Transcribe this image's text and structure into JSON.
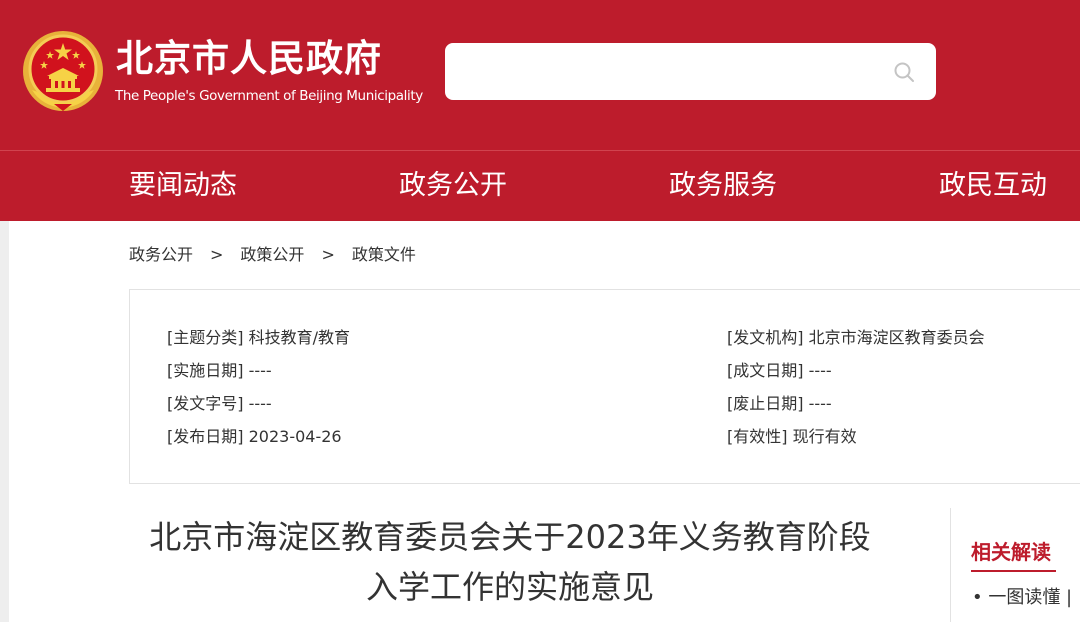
{
  "header": {
    "title": "北京市人民政府",
    "subtitle": "The People's Government of Beijing Municipality",
    "emblem_icon": "national-emblem-icon",
    "background_color": "#bd1c2c"
  },
  "search": {
    "value": "",
    "placeholder": "",
    "icon": "search-icon"
  },
  "nav": {
    "items": [
      {
        "label": "要闻动态"
      },
      {
        "label": "政务公开"
      },
      {
        "label": "政务服务"
      },
      {
        "label": "政民互动"
      }
    ]
  },
  "breadcrumb": {
    "items": [
      "政务公开",
      "政策公开",
      "政策文件"
    ],
    "separator": ">"
  },
  "meta": {
    "left": [
      {
        "label": "[主题分类]",
        "value": "科技教育/教育"
      },
      {
        "label": "[实施日期]",
        "value": "----"
      },
      {
        "label": "[发文字号]",
        "value": "----"
      },
      {
        "label": "[发布日期]",
        "value": "2023-04-26"
      }
    ],
    "right": [
      {
        "label": "[发文机构]",
        "value": "北京市海淀区教育委员会"
      },
      {
        "label": "[成文日期]",
        "value": "----"
      },
      {
        "label": "[废止日期]",
        "value": "----"
      },
      {
        "label": "[有效性]",
        "value": "现行有效"
      }
    ]
  },
  "document": {
    "title_line1": "北京市海淀区教育委员会关于2023年义务教育阶段",
    "title_line2": "入学工作的实施意见"
  },
  "related": {
    "title": "相关解读",
    "items": [
      "• 一图读懂 |"
    ],
    "accent_color": "#bd1c2c"
  }
}
